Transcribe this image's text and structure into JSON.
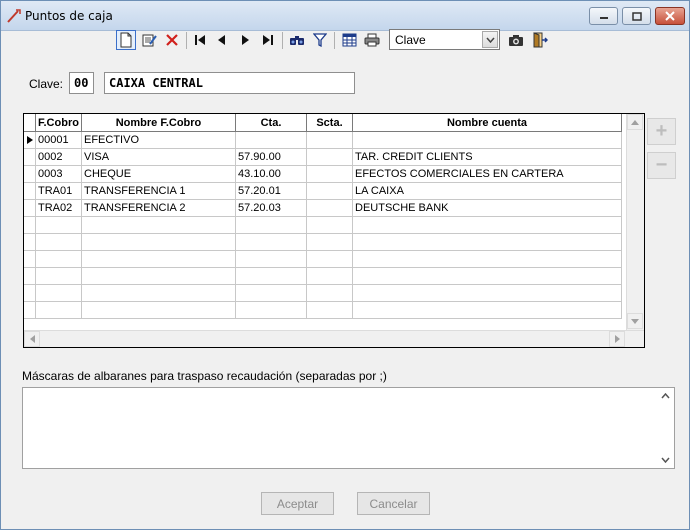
{
  "window": {
    "title": "Puntos de caja",
    "accent": "#c7503a"
  },
  "toolbar": {
    "items": [
      {
        "name": "new-icon"
      },
      {
        "name": "edit-icon"
      },
      {
        "name": "delete-icon"
      },
      {
        "name": "first-record-icon"
      },
      {
        "name": "prev-record-icon"
      },
      {
        "name": "next-record-icon"
      },
      {
        "name": "last-record-icon"
      },
      {
        "name": "find-icon"
      },
      {
        "name": "filter-icon"
      },
      {
        "name": "grid-view-icon"
      },
      {
        "name": "print-icon"
      }
    ],
    "order_select": {
      "value": "Clave"
    },
    "extra": [
      {
        "name": "camera-icon"
      },
      {
        "name": "exit-icon"
      }
    ]
  },
  "clave": {
    "label": "Clave:",
    "code": "00",
    "name": "CAIXA CENTRAL"
  },
  "grid": {
    "columns": [
      "F.Cobro",
      "Nombre F.Cobro",
      "Cta.",
      "Scta.",
      "Nombre cuenta"
    ],
    "rows": [
      [
        "00001",
        "EFECTIVO",
        "",
        "",
        ""
      ],
      [
        "0002",
        "VISA",
        "57.90.00",
        "",
        "TAR. CREDIT CLIENTS"
      ],
      [
        "0003",
        "CHEQUE",
        "43.10.00",
        "",
        "EFECTOS COMERCIALES EN CARTERA"
      ],
      [
        "TRA01",
        "TRANSFERENCIA 1",
        "57.20.01",
        "",
        "LA CAIXA"
      ],
      [
        "TRA02",
        "TRANSFERENCIA 2",
        "57.20.03",
        "",
        "DEUTSCHE BANK"
      ],
      [
        "",
        "",
        "",
        "",
        ""
      ],
      [
        "",
        "",
        "",
        "",
        ""
      ],
      [
        "",
        "",
        "",
        "",
        ""
      ],
      [
        "",
        "",
        "",
        "",
        ""
      ],
      [
        "",
        "",
        "",
        "",
        ""
      ],
      [
        "",
        "",
        "",
        "",
        ""
      ]
    ]
  },
  "side": {
    "add": "+",
    "remove": "−"
  },
  "memo": {
    "label": "Máscaras de albaranes para traspaso recaudación (separadas por ;)",
    "value": ""
  },
  "buttons": {
    "accept": "Aceptar",
    "cancel": "Cancelar"
  }
}
